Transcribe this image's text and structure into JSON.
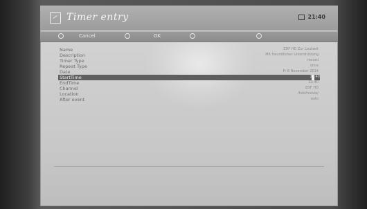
{
  "window": {
    "title": "Timer entry",
    "clock": "21:40"
  },
  "buttons": {
    "cancel": "Cancel",
    "ok": "OK"
  },
  "fields": [
    {
      "label": "Name",
      "value": "ZDF HD Zur Laufzeit"
    },
    {
      "label": "Description",
      "value": "Mit freundlicher Unterstützung"
    },
    {
      "label": "Timer Type",
      "value": "record"
    },
    {
      "label": "Repeat Type",
      "value": "once"
    },
    {
      "label": "Date",
      "value": "Fr 8 November 2014"
    },
    {
      "label": "StartTime",
      "value": "21:40"
    },
    {
      "label": "EndTime",
      "value": "22:40"
    },
    {
      "label": "Channel",
      "value": "ZDF HD"
    },
    {
      "label": "Location",
      "value": "/hdd/movie/"
    },
    {
      "label": "After event",
      "value": "auto"
    }
  ]
}
